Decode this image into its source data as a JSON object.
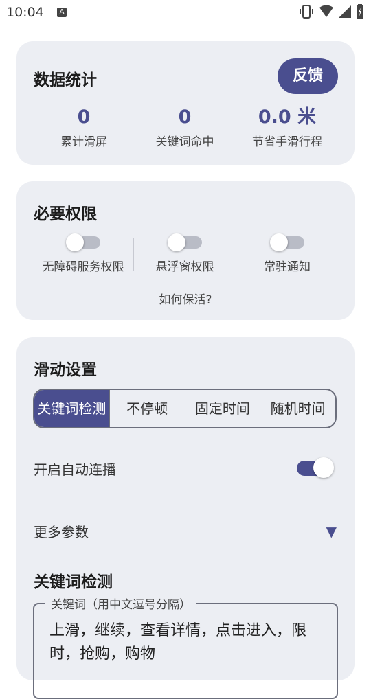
{
  "status_bar": {
    "time": "10:04",
    "badge": "A",
    "icons": [
      "vibrate-icon",
      "wifi-icon",
      "cell-signal-icon",
      "battery-icon"
    ]
  },
  "stats": {
    "title": "数据统计",
    "feedback_label": "反馈",
    "items": [
      {
        "value": "0",
        "label": "累计滑屏"
      },
      {
        "value": "0",
        "label": "关键词命中"
      },
      {
        "value": "0.0 米",
        "label": "节省手滑行程"
      }
    ]
  },
  "permissions": {
    "title": "必要权限",
    "items": [
      {
        "label": "无障碍服务权限",
        "enabled": false
      },
      {
        "label": "悬浮窗权限",
        "enabled": false
      },
      {
        "label": "常驻通知",
        "enabled": false
      }
    ],
    "help_link": "如何保活?"
  },
  "slide_settings": {
    "title": "滑动设置",
    "modes": [
      "关键词检测",
      "不停顿",
      "固定时间",
      "随机时间"
    ],
    "selected_mode": "关键词检测",
    "autoplay_label": "开启自动连播",
    "autoplay_enabled": true,
    "more_params_label": "更多参数",
    "more_params_icon": "▼",
    "keyword_section_title": "关键词检测",
    "keyword_field": {
      "label": "关键词（用中文逗号分隔）",
      "value": "上滑，继续，查看详情，点击进入，限时，抢购，购物"
    }
  },
  "colors": {
    "accent": "#4a4e8f",
    "card_bg": "#eceef3",
    "toggle_off": "#b9bcc6"
  }
}
